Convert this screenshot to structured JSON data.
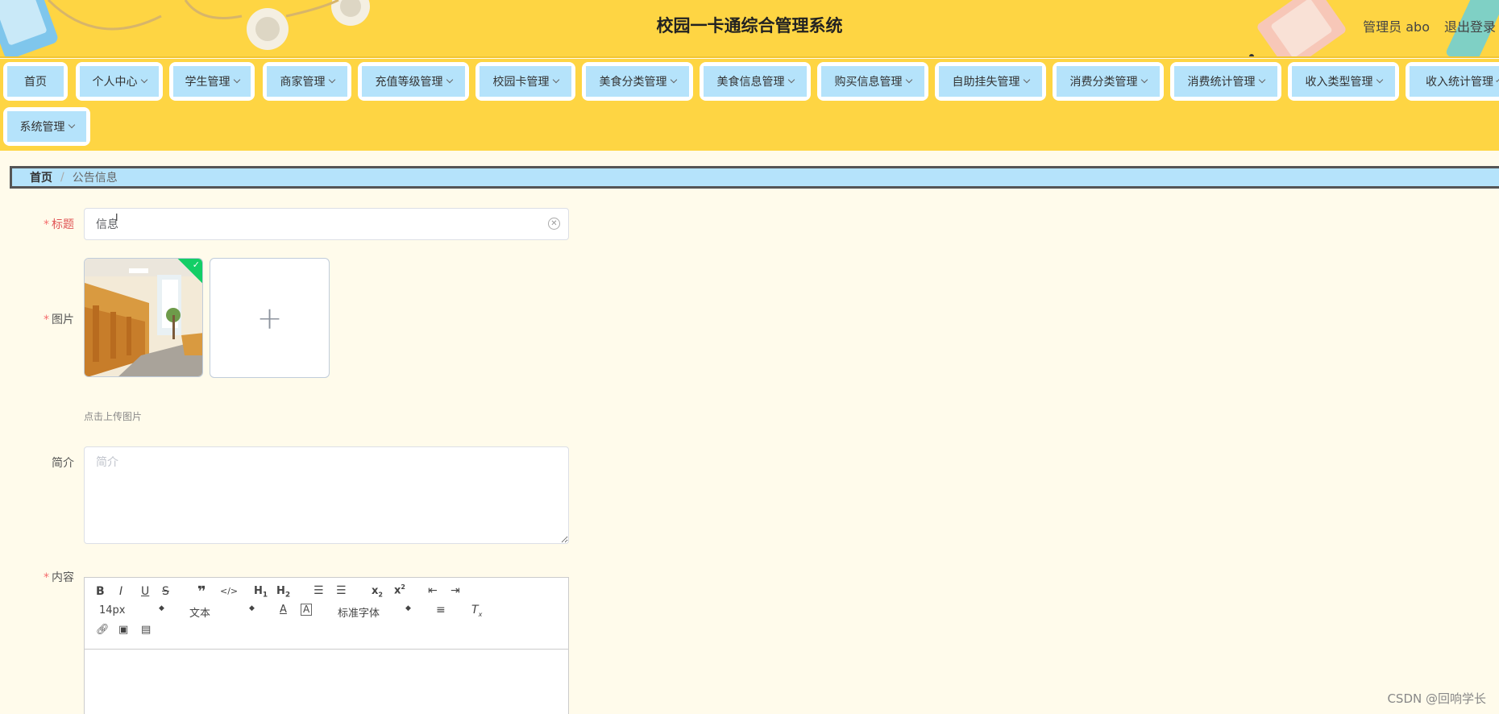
{
  "header": {
    "title": "校园一卡通综合管理系统",
    "user": "管理员 abo",
    "logout": "退出登录"
  },
  "nav": {
    "items": [
      {
        "label": "首页",
        "dropdown": false
      },
      {
        "label": "个人中心",
        "dropdown": true
      },
      {
        "label": "学生管理",
        "dropdown": true
      },
      {
        "label": "商家管理",
        "dropdown": true
      },
      {
        "label": "充值等级管理",
        "dropdown": true
      },
      {
        "label": "校园卡管理",
        "dropdown": true
      },
      {
        "label": "美食分类管理",
        "dropdown": true
      },
      {
        "label": "美食信息管理",
        "dropdown": true
      },
      {
        "label": "购买信息管理",
        "dropdown": true
      },
      {
        "label": "自助挂失管理",
        "dropdown": true
      },
      {
        "label": "消费分类管理",
        "dropdown": true
      },
      {
        "label": "消费统计管理",
        "dropdown": true
      },
      {
        "label": "收入类型管理",
        "dropdown": true
      },
      {
        "label": "收入统计管理",
        "dropdown": true
      },
      {
        "label": "系统管理",
        "dropdown": true
      }
    ]
  },
  "breadcrumb": {
    "home": "首页",
    "separator": "/",
    "current": "公告信息"
  },
  "form": {
    "title_label": "标题",
    "title_value": "信息",
    "image_label": "图片",
    "upload_tip": "点击上传图片",
    "intro_label": "简介",
    "intro_placeholder": "简介",
    "content_label": "内容",
    "required_mark": "*"
  },
  "editor": {
    "font_size": "14px",
    "header_select": "文本",
    "font_family": "标准字体"
  },
  "watermark": "CSDN @回响学长",
  "colors": {
    "header_bg": "#fed543",
    "nav_button_bg": "#b5e3fb",
    "page_bg": "#fffbeb",
    "success": "#13ce66"
  }
}
